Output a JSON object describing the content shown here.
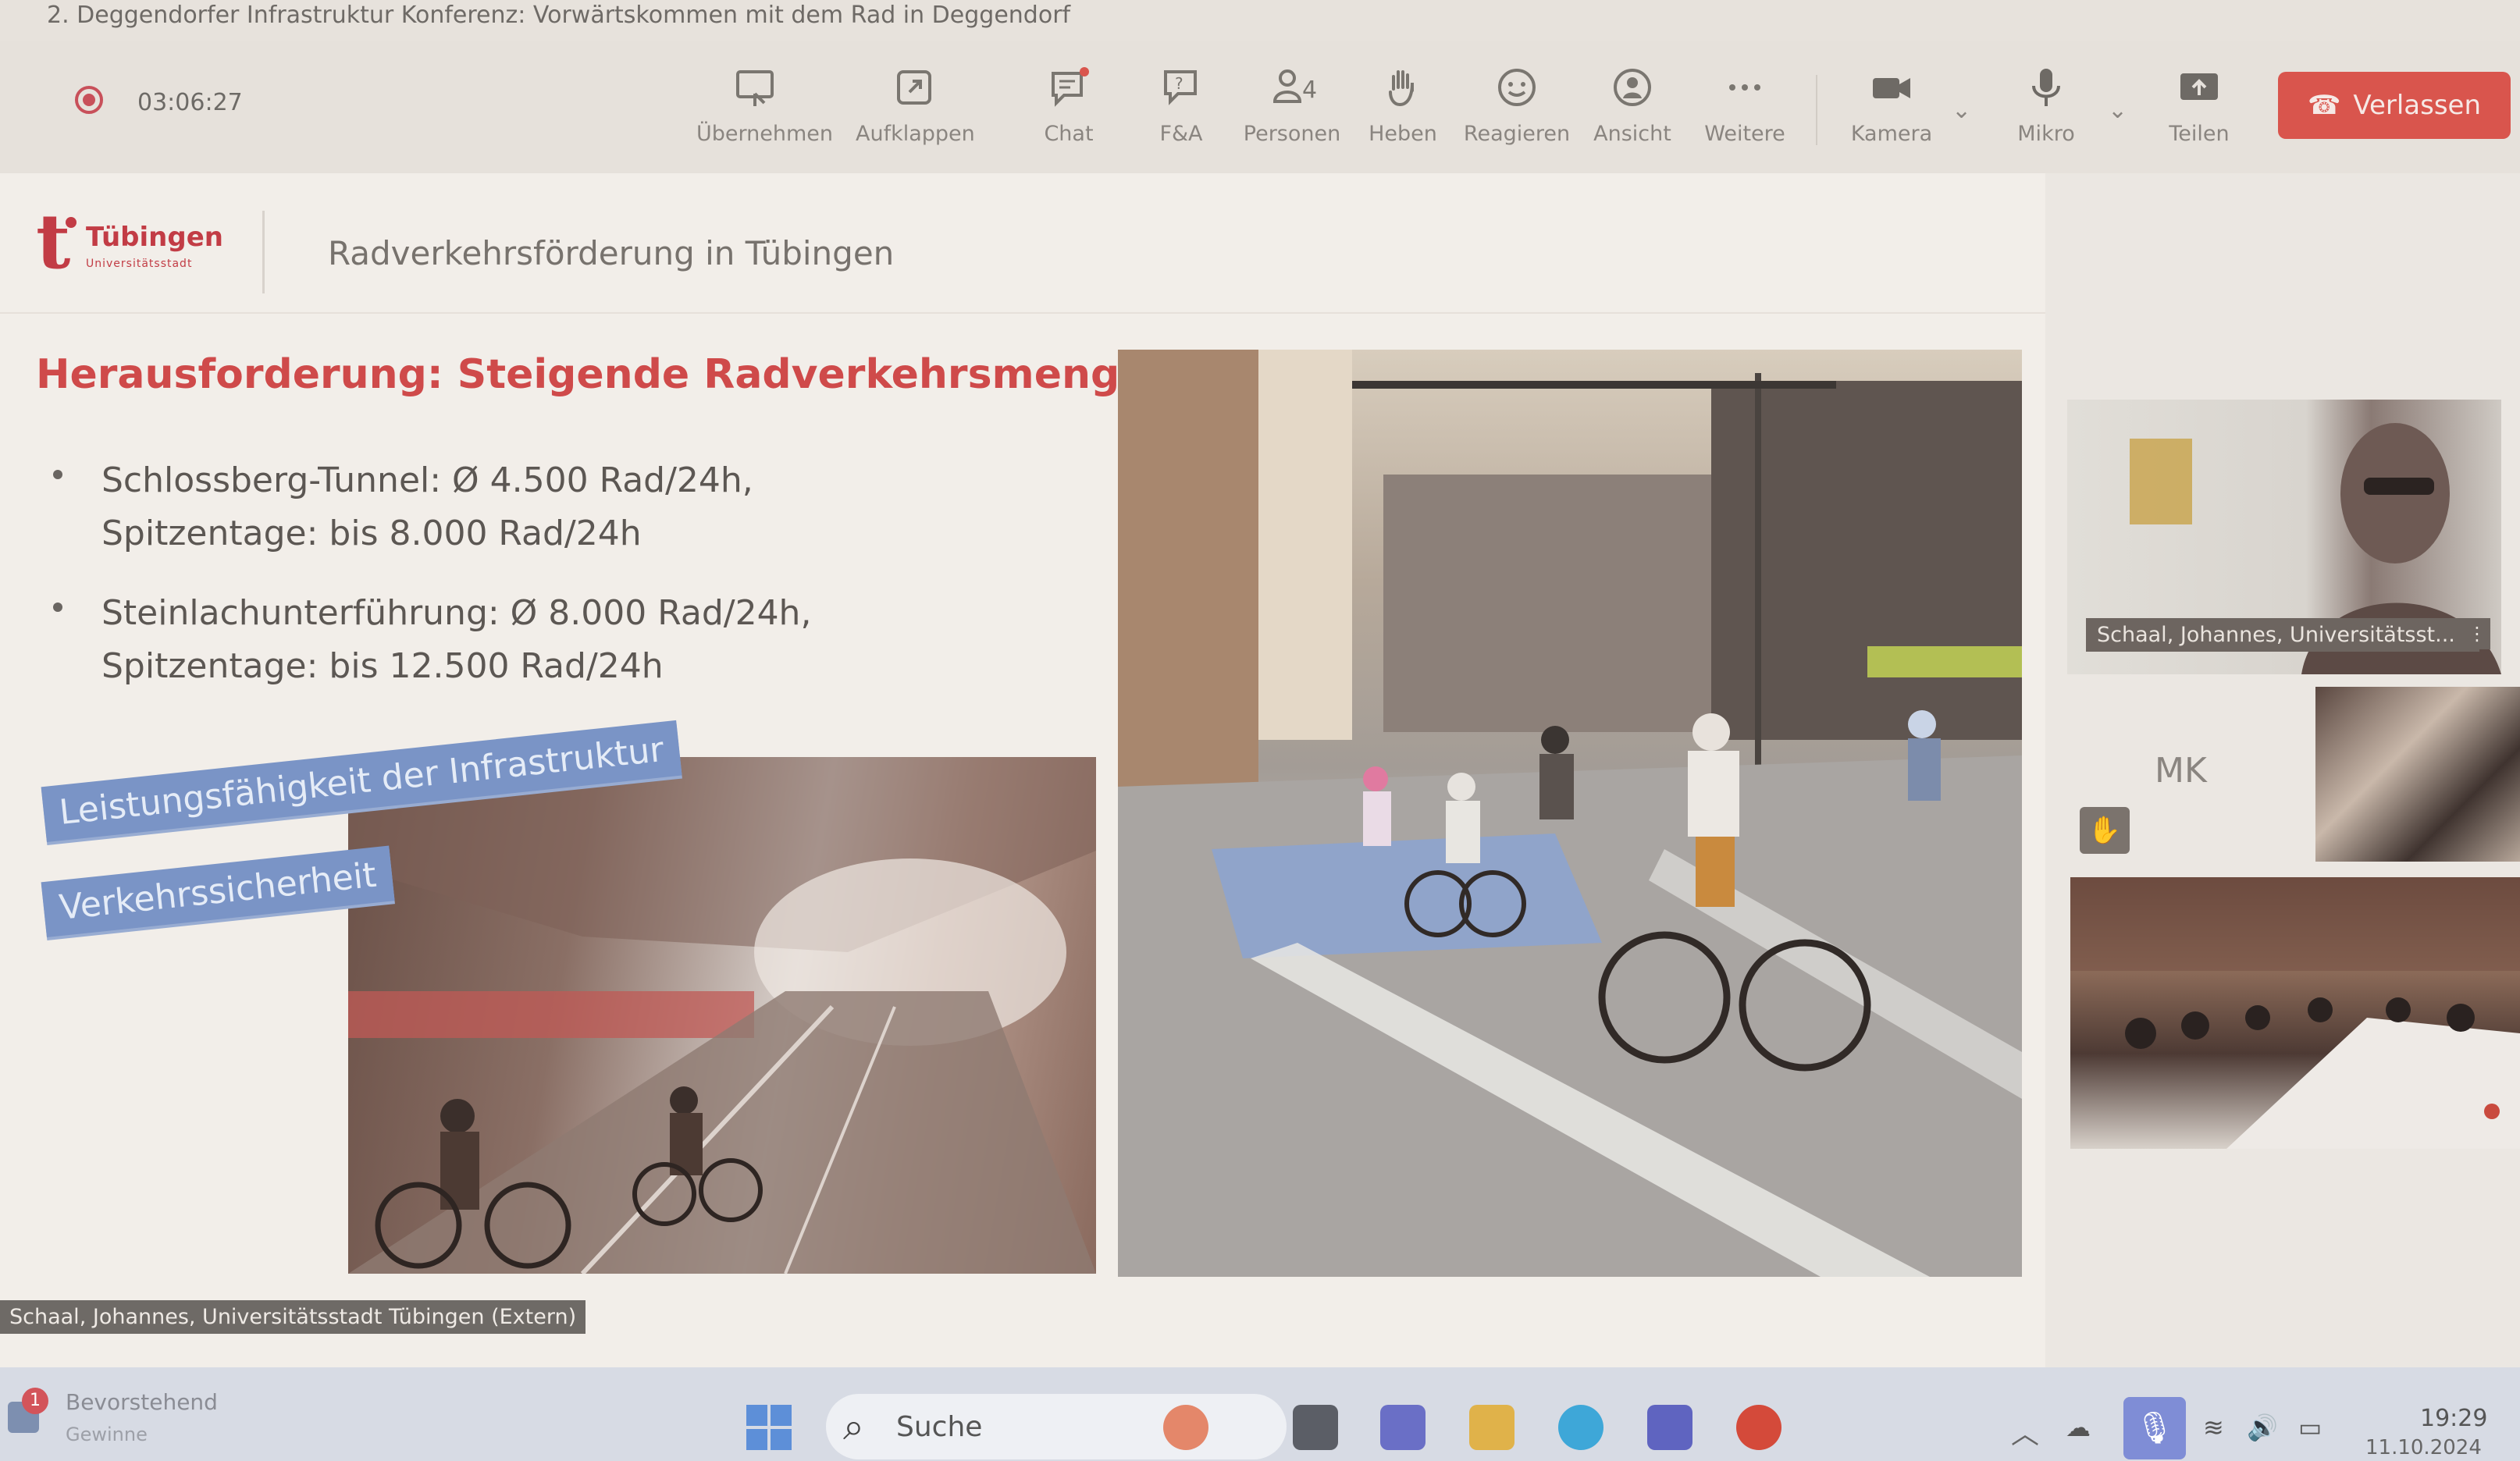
{
  "window": {
    "title": "2. Deggendorfer Infrastruktur Konferenz: Vorwärtskommen mit dem Rad in Deggendorf"
  },
  "toolbar": {
    "timer": "03:06:27",
    "buttons": [
      {
        "label": "Übernehmen",
        "icon": "share-screen-icon"
      },
      {
        "label": "Aufklappen",
        "icon": "popout-icon"
      },
      {
        "label": "Chat",
        "icon": "chat-icon"
      },
      {
        "label": "F&A",
        "icon": "qa-icon"
      },
      {
        "label": "Personen",
        "icon": "people-icon",
        "count": "4"
      },
      {
        "label": "Heben",
        "icon": "raise-hand-icon"
      },
      {
        "label": "Reagieren",
        "icon": "reaction-icon"
      },
      {
        "label": "Ansicht",
        "icon": "view-icon"
      },
      {
        "label": "Weitere",
        "icon": "more-icon"
      },
      {
        "label": "Kamera",
        "icon": "camera-icon"
      },
      {
        "label": "Mikro",
        "icon": "microphone-icon"
      },
      {
        "label": "Teilen",
        "icon": "share-icon"
      }
    ],
    "leave_label": "Verlassen",
    "leave_color": "#d9554d",
    "chat_badge_color": "#d9554d"
  },
  "slide": {
    "logo_name": "Tübingen",
    "logo_sub": "Universitätsstadt",
    "header": "Radverkehrsförderung in Tübingen",
    "heading": "Herausforderung: Steigende Radverkehrsmengen",
    "heading_color": "#cf4a4a",
    "bullets": [
      {
        "line1": "Schlossberg-Tunnel: Ø 4.500 Rad/24h,",
        "line2": "Spitzentage: bis 8.000 Rad/24h"
      },
      {
        "line1": "Steinlachunterführung: Ø 8.000 Rad/24h,",
        "line2": "Spitzentage: bis 12.500 Rad/24h"
      }
    ],
    "tags": [
      "Leistungsfähigkeit der Infrastruktur",
      "Verkehrssicherheit"
    ],
    "tag_color": "#7a94c6"
  },
  "participants": {
    "top_video_label": "Schaal, Johannes, Universitätsst...",
    "mk_initials": "MK"
  },
  "presenter_label": "Schaal, Johannes, Universitätsstadt Tübingen (Extern)",
  "taskbar": {
    "notification_count": "1",
    "notification_title": "Bevorstehend",
    "notification_sub": "Gewinne",
    "search_placeholder": "Suche",
    "time": "19:29",
    "date": "11.10.2024"
  }
}
